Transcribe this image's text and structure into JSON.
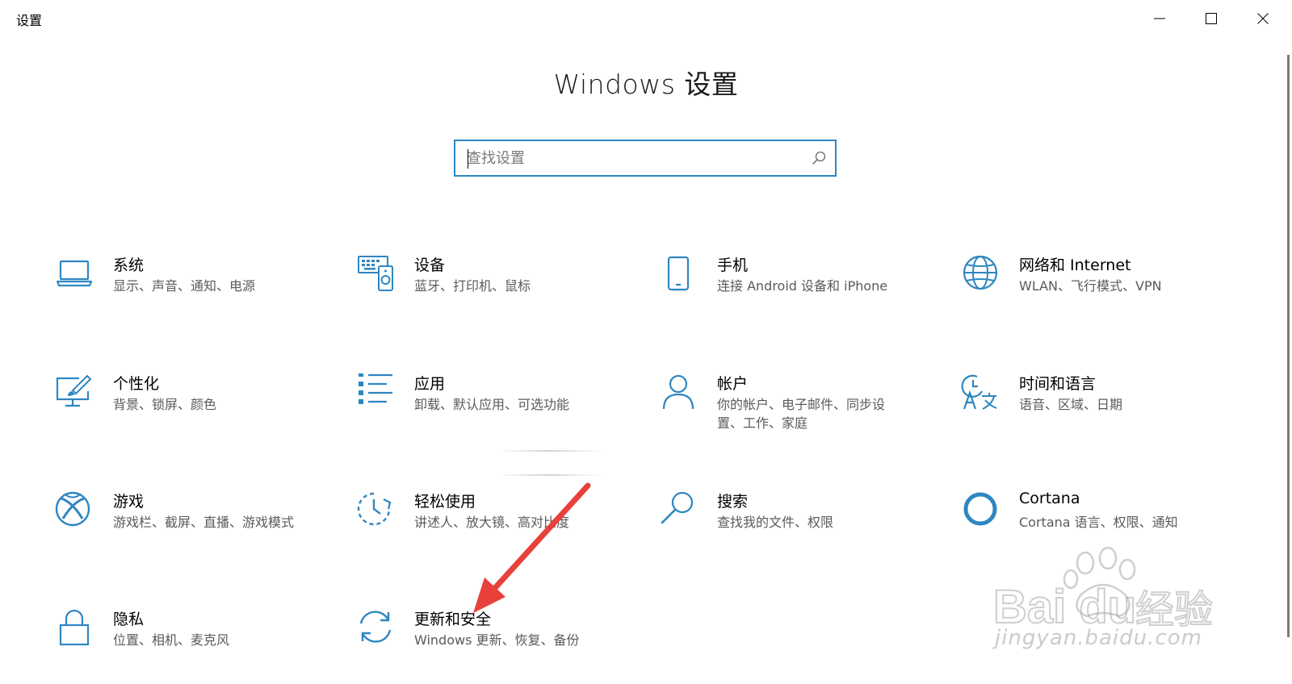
{
  "window": {
    "app_title": "设置",
    "page_title": "Windows 设置"
  },
  "search": {
    "placeholder": "查找设置",
    "value": ""
  },
  "tiles": [
    {
      "id": "system",
      "name": "系统",
      "desc": "显示、声音、通知、电源",
      "icon": "laptop-icon"
    },
    {
      "id": "devices",
      "name": "设备",
      "desc": "蓝牙、打印机、鼠标",
      "icon": "devices-icon"
    },
    {
      "id": "phone",
      "name": "手机",
      "desc": "连接 Android 设备和 iPhone",
      "icon": "phone-icon"
    },
    {
      "id": "network",
      "name": "网络和 Internet",
      "desc": "WLAN、飞行模式、VPN",
      "icon": "globe-icon"
    },
    {
      "id": "personalization",
      "name": "个性化",
      "desc": "背景、锁屏、颜色",
      "icon": "paint-icon"
    },
    {
      "id": "apps",
      "name": "应用",
      "desc": "卸载、默认应用、可选功能",
      "icon": "apps-list-icon"
    },
    {
      "id": "accounts",
      "name": "帐户",
      "desc": "你的帐户、电子邮件、同步设置、工作、家庭",
      "icon": "person-icon"
    },
    {
      "id": "time-language",
      "name": "时间和语言",
      "desc": "语音、区域、日期",
      "icon": "time-language-icon"
    },
    {
      "id": "gaming",
      "name": "游戏",
      "desc": "游戏栏、截屏、直播、游戏模式",
      "icon": "xbox-icon"
    },
    {
      "id": "ease-of-access",
      "name": "轻松使用",
      "desc": "讲述人、放大镜、高对比度",
      "icon": "ease-of-access-icon"
    },
    {
      "id": "search",
      "name": "搜索",
      "desc": "查找我的文件、权限",
      "icon": "magnifier-icon"
    },
    {
      "id": "cortana",
      "name": "Cortana",
      "desc": "Cortana 语言、权限、通知",
      "icon": "cortana-icon"
    },
    {
      "id": "privacy",
      "name": "隐私",
      "desc": "位置、相机、麦克风",
      "icon": "lock-icon"
    },
    {
      "id": "update-security",
      "name": "更新和安全",
      "desc": "Windows 更新、恢复、备份",
      "icon": "sync-icon"
    }
  ],
  "watermark": {
    "text": "jingyan.baidu.com"
  },
  "colors": {
    "accent": "#2e86c1",
    "annotation_arrow": "#e8413c"
  }
}
